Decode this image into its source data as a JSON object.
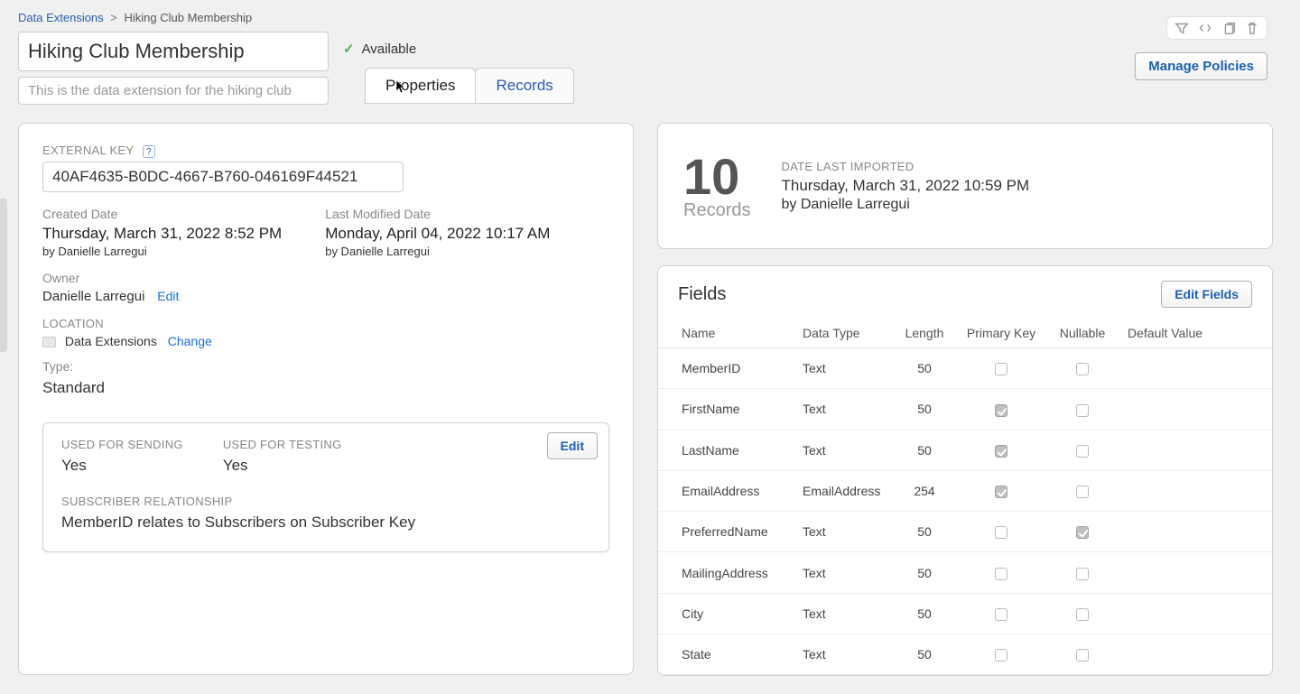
{
  "breadcrumb": {
    "root": "Data Extensions",
    "current": "Hiking Club Membership",
    "sep": ">"
  },
  "header": {
    "title": "Hiking Club Membership",
    "description": "This is the data extension for the hiking club",
    "status": "Available"
  },
  "tabs": {
    "properties": "Properties",
    "records": "Records"
  },
  "buttons": {
    "manage_policies": "Manage Policies",
    "edit": "Edit",
    "change": "Change",
    "edit_fields": "Edit Fields"
  },
  "props": {
    "external_key_label": "EXTERNAL KEY",
    "external_key": "40AF4635-B0DC-4667-B760-046169F44521",
    "created_label": "Created Date",
    "created_value": "Thursday, March 31, 2022 8:52 PM",
    "created_by": "by Danielle Larregui",
    "modified_label": "Last Modified Date",
    "modified_value": "Monday, April 04, 2022 10:17 AM",
    "modified_by": "by Danielle Larregui",
    "owner_label": "Owner",
    "owner_value": "Danielle Larregui",
    "location_label": "LOCATION",
    "location_value": "Data Extensions",
    "type_label": "Type:",
    "type_value": "Standard"
  },
  "usage": {
    "sending_label": "USED FOR SENDING",
    "sending_value": "Yes",
    "testing_label": "USED FOR TESTING",
    "testing_value": "Yes",
    "sub_rel_label": "SUBSCRIBER RELATIONSHIP",
    "sub_rel_value": "MemberID relates to Subscribers on Subscriber Key"
  },
  "summary": {
    "count": "10",
    "count_label": "Records",
    "import_label": "DATE LAST IMPORTED",
    "import_value": "Thursday, March 31, 2022 10:59 PM",
    "import_by": "by Danielle Larregui"
  },
  "fields": {
    "title": "Fields",
    "cols": {
      "name": "Name",
      "type": "Data Type",
      "length": "Length",
      "pk": "Primary Key",
      "nullable": "Nullable",
      "default": "Default Value"
    },
    "rows": [
      {
        "name": "MemberID",
        "type": "Text",
        "length": "50",
        "pk": false,
        "nullable": false,
        "default": ""
      },
      {
        "name": "FirstName",
        "type": "Text",
        "length": "50",
        "pk": true,
        "nullable": false,
        "default": ""
      },
      {
        "name": "LastName",
        "type": "Text",
        "length": "50",
        "pk": true,
        "nullable": false,
        "default": ""
      },
      {
        "name": "EmailAddress",
        "type": "EmailAddress",
        "length": "254",
        "pk": true,
        "nullable": false,
        "default": ""
      },
      {
        "name": "PreferredName",
        "type": "Text",
        "length": "50",
        "pk": false,
        "nullable": true,
        "default": ""
      },
      {
        "name": "MailingAddress",
        "type": "Text",
        "length": "50",
        "pk": false,
        "nullable": false,
        "default": ""
      },
      {
        "name": "City",
        "type": "Text",
        "length": "50",
        "pk": false,
        "nullable": false,
        "default": ""
      },
      {
        "name": "State",
        "type": "Text",
        "length": "50",
        "pk": false,
        "nullable": false,
        "default": ""
      }
    ]
  }
}
